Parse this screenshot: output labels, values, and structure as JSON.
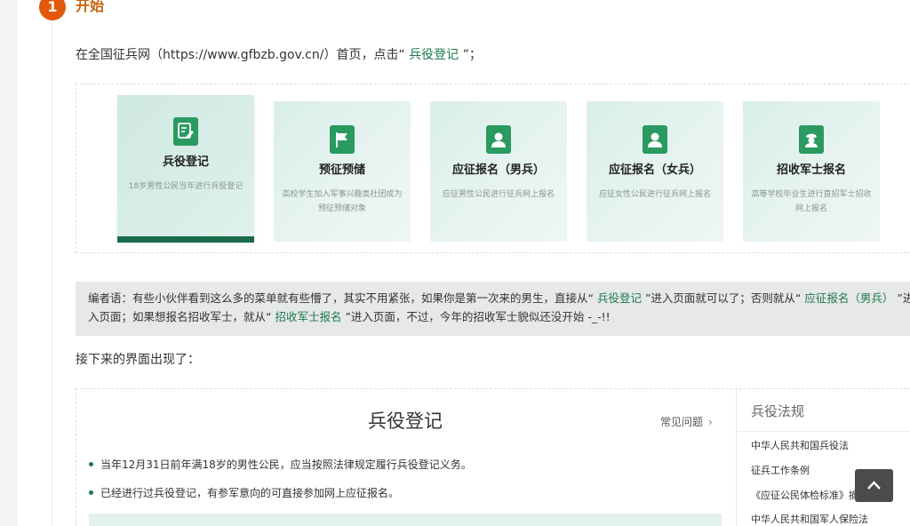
{
  "step": {
    "number": "1",
    "title": "开始"
  },
  "intro": {
    "before": "在全国征兵网（https://www.gfbzb.gov.cn/）首页，点击“",
    "link": " 兵役登记 ",
    "after": "”；"
  },
  "cards": [
    {
      "title": "兵役登记",
      "desc": "18岁男性公民当年进行兵役登记",
      "icon": "edit-form-icon",
      "active": true
    },
    {
      "title": "预征预储",
      "desc": "高校学生加入军事兴趣类社团成为预征预储对象",
      "icon": "flag-icon",
      "active": false
    },
    {
      "title": "应征报名（男兵）",
      "desc": "应征男性公民进行征兵网上报名",
      "icon": "person-icon",
      "active": false
    },
    {
      "title": "应征报名（女兵）",
      "desc": "应征女性公民进行征兵网上报名",
      "icon": "person-icon",
      "active": false
    },
    {
      "title": "招收军士报名",
      "desc": "高等学校毕业生进行直招军士招收网上报名",
      "icon": "soldier-icon",
      "active": false
    }
  ],
  "note": {
    "p1": "编者语：有些小伙伴看到这么多的菜单就有些懵了，其实不用紧张，如果你是第一次来的男生，直接从“",
    "link1": " 兵役登记 ",
    "p2": "”进入页面就可以了；否则就从“",
    "link2": " 应征报名（男兵） ",
    "p3": "”进入页面；如果想报名招收军士，就从“",
    "link3": " 招收军士报名 ",
    "p4": "”进入页面，不过，今年的招收军士貌似还没开始 -_-!!"
  },
  "next_text": "接下来的界面出现了：",
  "registration": {
    "title": "兵役登记",
    "faq_label": "常见问题",
    "rules": [
      "当年12月31日前年满18岁的男性公民，应当按照法律规定履行兵役登记义务。",
      "已经进行过兵役登记，有参军意向的可直接参加网上应征报名。"
    ]
  },
  "sidebar": {
    "heading": "兵役法规",
    "links": [
      "中华人民共和国兵役法",
      "征兵工作条例",
      "《应征公民体检标准》摘要",
      "中华人民共和国军人保险法"
    ]
  },
  "colors": {
    "accent_orange": "#e2580b",
    "link_green": "#1e7a4c",
    "icon_green": "#2a9a61",
    "active_bar": "#1a6b4a"
  }
}
